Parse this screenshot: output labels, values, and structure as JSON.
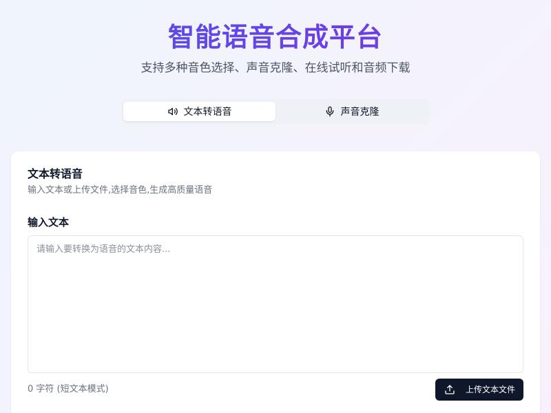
{
  "hero": {
    "title": "智能语音合成平台",
    "subtitle": "支持多种音色选择、声音克隆、在线试听和音频下载"
  },
  "tabs": [
    {
      "label": "文本转语音",
      "icon": "speaker-icon",
      "active": true
    },
    {
      "label": "声音克隆",
      "icon": "microphone-icon",
      "active": false
    }
  ],
  "card": {
    "title": "文本转语音",
    "description": "输入文本或上传文件,选择音色,生成高质量语音",
    "field_label": "输入文本",
    "textarea": {
      "value": "",
      "placeholder": "请输入要转换为语音的文本内容..."
    },
    "char_count": "0 字符 (短文本模式)",
    "upload_button": {
      "label": "上传文本文件",
      "icon": "upload-icon"
    }
  },
  "colors": {
    "title_gradient_start": "#4f55e6",
    "title_gradient_end": "#7a3ae4",
    "primary_button": "#0f172a"
  }
}
